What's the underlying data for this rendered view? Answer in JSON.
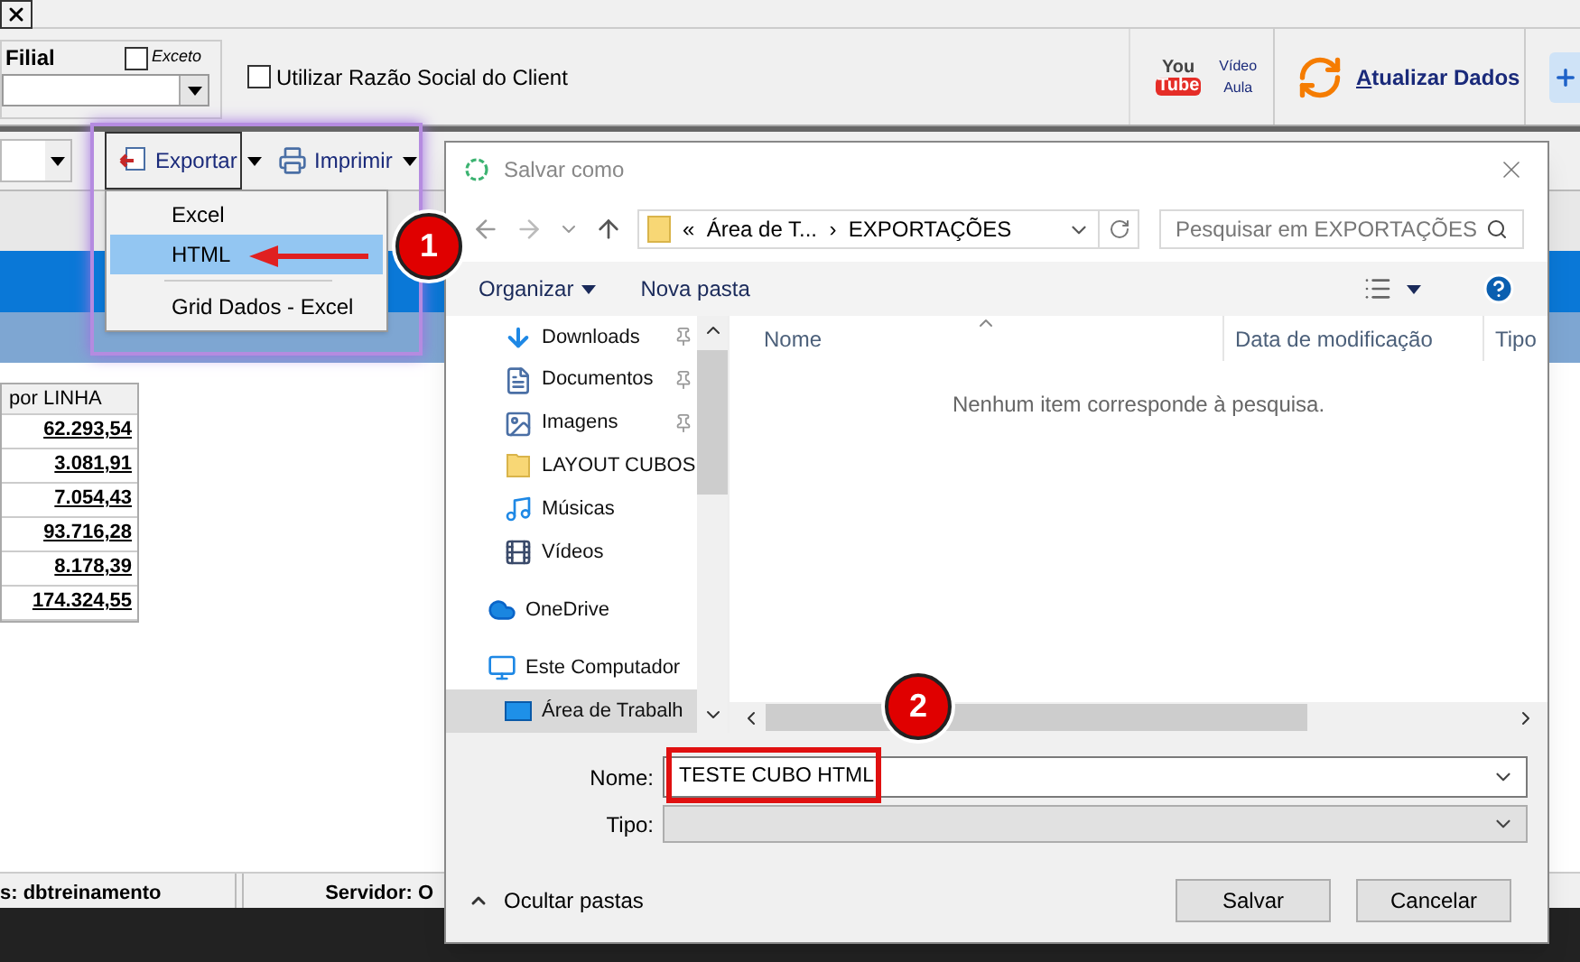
{
  "app": {
    "filter": {
      "label": "Filial",
      "except": {
        "label": "Exceto",
        "checked": false
      }
    },
    "razao_social": {
      "label": "Utilizar Razão Social do Client",
      "checked": false
    },
    "youtube_logo": [
      "You",
      "Tube"
    ],
    "video_lesson": [
      "Vídeo",
      "Aula"
    ],
    "refresh": {
      "label": "Atualizar Dados"
    },
    "toolbar": {
      "export": "Exportar",
      "print": "Imprimir"
    },
    "export_menu": [
      {
        "kind": "item",
        "label": "Excel",
        "selected": false
      },
      {
        "kind": "item",
        "label": "HTML",
        "selected": true
      },
      {
        "kind": "separator"
      },
      {
        "kind": "item",
        "label": "Grid Dados - Excel",
        "selected": false
      }
    ],
    "table": {
      "column": "por LINHA",
      "rows": [
        "62.293,54",
        "3.081,91",
        "7.054,43",
        "93.716,28",
        "8.178,39",
        "174.324,55"
      ]
    },
    "status_bar": [
      "s: dbtreinamento",
      "Servidor: O"
    ]
  },
  "annotations": [
    "1",
    "2"
  ],
  "dialog": {
    "title": "Salvar como",
    "address": {
      "prefix": "«",
      "parent": "Área de T...",
      "separator": "›",
      "current": "EXPORTAÇÕES"
    },
    "search": {
      "placeholder": "Pesquisar em EXPORTAÇÕES"
    },
    "commands": {
      "organize": "Organizar",
      "new_folder": "Nova pasta"
    },
    "quick_access": [
      {
        "label": "Downloads",
        "kind": "download",
        "pinned": true,
        "selected": false
      },
      {
        "label": "Documentos",
        "kind": "documents",
        "pinned": true,
        "selected": false
      },
      {
        "label": "Imagens",
        "kind": "images",
        "pinned": true,
        "selected": false
      },
      {
        "label": "LAYOUT CUBOS",
        "kind": "folder",
        "pinned": false,
        "selected": false
      },
      {
        "label": "Músicas",
        "kind": "music",
        "pinned": false,
        "selected": false
      },
      {
        "label": "Vídeos",
        "kind": "videos",
        "pinned": false,
        "selected": false
      }
    ],
    "locations": [
      {
        "label": "OneDrive",
        "kind": "onedrive",
        "selected": false
      },
      {
        "label": "Este Computador",
        "kind": "computer",
        "selected": false,
        "children": [
          {
            "label": "Área de Trabalh",
            "kind": "desktop",
            "selected": true
          }
        ]
      }
    ],
    "columns": [
      "Nome",
      "Data de modificação",
      "Tipo"
    ],
    "empty_message": "Nenhum item corresponde à pesquisa.",
    "filename": {
      "label": "Nome:",
      "value": "TESTE CUBO HTML"
    },
    "file_type": {
      "label": "Tipo:",
      "disabled": true
    },
    "hide_folders": "Ocultar pastas",
    "buttons": [
      "Salvar",
      "Cancelar"
    ]
  }
}
